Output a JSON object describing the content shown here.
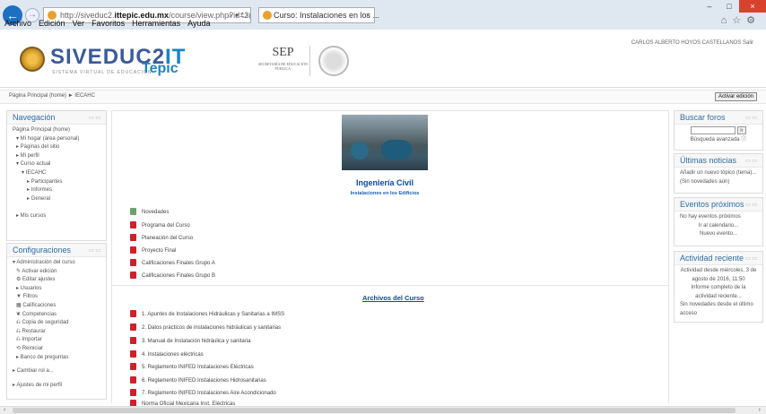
{
  "browser": {
    "url_scheme": "http://siveduc2.",
    "url_host": "ittepic.edu.mx",
    "url_path": "/course/view.php?id=3(",
    "url_controls": "⌕ ▾ ↻",
    "tab_title": "Curso: Instalaciones en los ...",
    "tab_close": "×",
    "back_glyph": "←",
    "forward_glyph": "→",
    "win_minimize": "–",
    "win_maximize": "□",
    "win_close": "×",
    "toolbar_icons": "⌂☆⚙",
    "menu": [
      "Archivo",
      "Edición",
      "Ver",
      "Favoritos",
      "Herramientas",
      "Ayuda"
    ]
  },
  "header": {
    "brand_main": "SIVEDUC2",
    "brand_it": "IT",
    "brand_sub": "SISTEMA VIRTUAL DE EDUCACIÓN",
    "brand_tepic": "Tepic",
    "sep_label": "SEP",
    "sep_sub": "SECRETARÍA DE EDUCACIÓN PÚBLICA",
    "user_text": "CARLOS ALBERTO HOYOS CASTELLANOS  Salir"
  },
  "breadcrumb": "Página Principal (home) ► IECAHC",
  "edit_button": "Activar edición",
  "navigation": {
    "title": "Navegación",
    "items": [
      {
        "label": "Página Principal (home)",
        "level": 0
      },
      {
        "label": "▾ Mi hogar (área personal)",
        "level": 1
      },
      {
        "label": "▸ Páginas del sitio",
        "level": 1
      },
      {
        "label": "▸ Mi perfil",
        "level": 1
      },
      {
        "label": "▾ Curso actual",
        "level": 1
      },
      {
        "label": "▾ IECAHC",
        "level": 2
      },
      {
        "label": "▸ Participantes",
        "level": 3
      },
      {
        "label": "▸ Informes",
        "level": 3
      },
      {
        "label": "▸ General",
        "level": 3
      },
      {
        "label": "",
        "level": 1
      },
      {
        "label": "▸ Mis cursos",
        "level": 1
      }
    ]
  },
  "settings": {
    "title": "Configuraciones",
    "items": [
      "▾ Administración del curso",
      "✎ Activar edición",
      "⚙ Editar ajustes",
      "▸ Usuarios",
      "▼ Filtros",
      "▦ Calificaciones",
      "❦ Competencias",
      "⎌ Copia de seguridad",
      "⎌ Restaurar",
      "⎌ Importar",
      "⟲ Reiniciar",
      "▸ Banco de preguntas"
    ],
    "bottom": [
      "▸ Cambiar rol a...",
      "▸ Ajustes de mi perfil"
    ]
  },
  "course": {
    "title": "Ingeniería Civil",
    "subtitle": "Instalaciones en los Edificios",
    "resources_top": [
      {
        "label": "Novedades",
        "icon": "forum-icon"
      },
      {
        "label": "Programa del Curso",
        "icon": "pdf-icon"
      },
      {
        "label": "Planeación del Curso",
        "icon": "pdf-icon"
      },
      {
        "label": "Proyecto Final",
        "icon": "pdf-icon"
      },
      {
        "label": "Calificaciones Finales Grupo A",
        "icon": "pdf-icon"
      },
      {
        "label": "Calificaciones Finales Grupo B",
        "icon": "pdf-icon"
      }
    ],
    "archive_title": "Archivos del Curso",
    "resources_archive": [
      "1. Apuntes de Instalaciones Hidráulicas y Sanitarias a IMSS",
      "2. Datos prácticos de instalaciones hidráulicas y sanitarias",
      "3. Manual de Instalación hidráulica y sanitaria",
      "4. Instalaciones eléctricas",
      "5. Reglamento INIFED Instalaciones Eléctricas",
      "6. Reglamento INIFED Instalaciones Hidrosanitarias",
      "7. Reglamento INIFED Instalaciones Aire Acondicionado",
      "Norma Oficial Mexicana Inst. Eléctricas"
    ]
  },
  "blocks": {
    "forums": {
      "title": "Buscar foros",
      "button": "Ir",
      "advanced": "Búsqueda avanzada ⓘ"
    },
    "news": {
      "title": "Últimas noticias",
      "add": "Añadir un nuevo tópico (tema)...",
      "none": "(Sin novedades aún)"
    },
    "events": {
      "title": "Eventos próximos",
      "none": "No hay eventos próximos",
      "calendar": "Ir al calendario...",
      "new": "Nuevo evento..."
    },
    "recent": {
      "title": "Actividad reciente",
      "since": "Actividad desde miércoles, 3 de agosto de 2016, 11:50",
      "full": "Informe completo de la actividad reciente...",
      "none": "Sin novedades desde el último acceso"
    },
    "block_icons": "▭ ▭"
  },
  "scroll": {
    "left": "‹",
    "right": "›"
  }
}
